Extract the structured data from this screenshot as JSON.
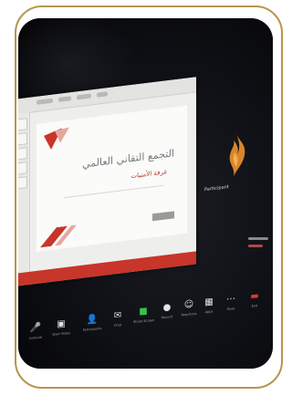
{
  "photo": {
    "frame_color": "#b8944f",
    "background_color": "#0d0e12"
  },
  "slide": {
    "title": "التجمع التقاني العالمي",
    "subtitle": "غرفة الأمنيات",
    "accent_color": "#c8352a"
  },
  "participant": {
    "name": "Participant",
    "avatar_icon": "flame-logo-icon"
  },
  "toolbar": {
    "items": [
      {
        "icon": "mic-icon",
        "label": "Unmute",
        "glyph": "🎤"
      },
      {
        "icon": "video-icon",
        "label": "Start Video",
        "glyph": "▣"
      },
      {
        "icon": "participants-icon",
        "label": "Participants",
        "glyph": "👤"
      },
      {
        "icon": "chat-icon",
        "label": "Chat",
        "glyph": "✉"
      },
      {
        "icon": "share-screen-icon",
        "label": "Share Screen",
        "glyph": "■"
      },
      {
        "icon": "record-icon",
        "label": "Record",
        "glyph": "●"
      },
      {
        "icon": "reactions-icon",
        "label": "Reactions",
        "glyph": "☺"
      },
      {
        "icon": "apps-icon",
        "label": "Apps",
        "glyph": "▦"
      },
      {
        "icon": "more-icon",
        "label": "More",
        "glyph": "⋯"
      },
      {
        "icon": "end-icon",
        "label": "End",
        "glyph": "▬"
      }
    ]
  }
}
